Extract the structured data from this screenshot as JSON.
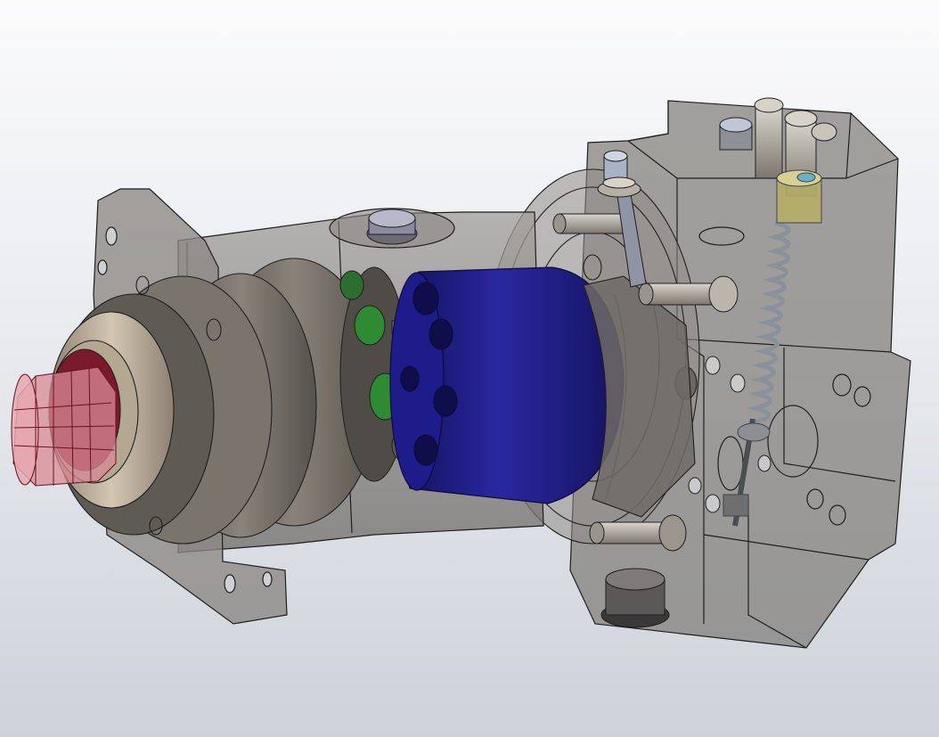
{
  "scene": {
    "colors": {
      "background_top": "#fbfbfc",
      "background_bottom": "#cdd2da",
      "housing": "#8b8782",
      "edges": "#1f1f1f",
      "shaft": "#c24a5e",
      "cylinder_block": "#1c1a7a",
      "piston_shoes": "#2f8a34",
      "collar": "#b8a892",
      "spring": "#9aa1ab"
    }
  }
}
